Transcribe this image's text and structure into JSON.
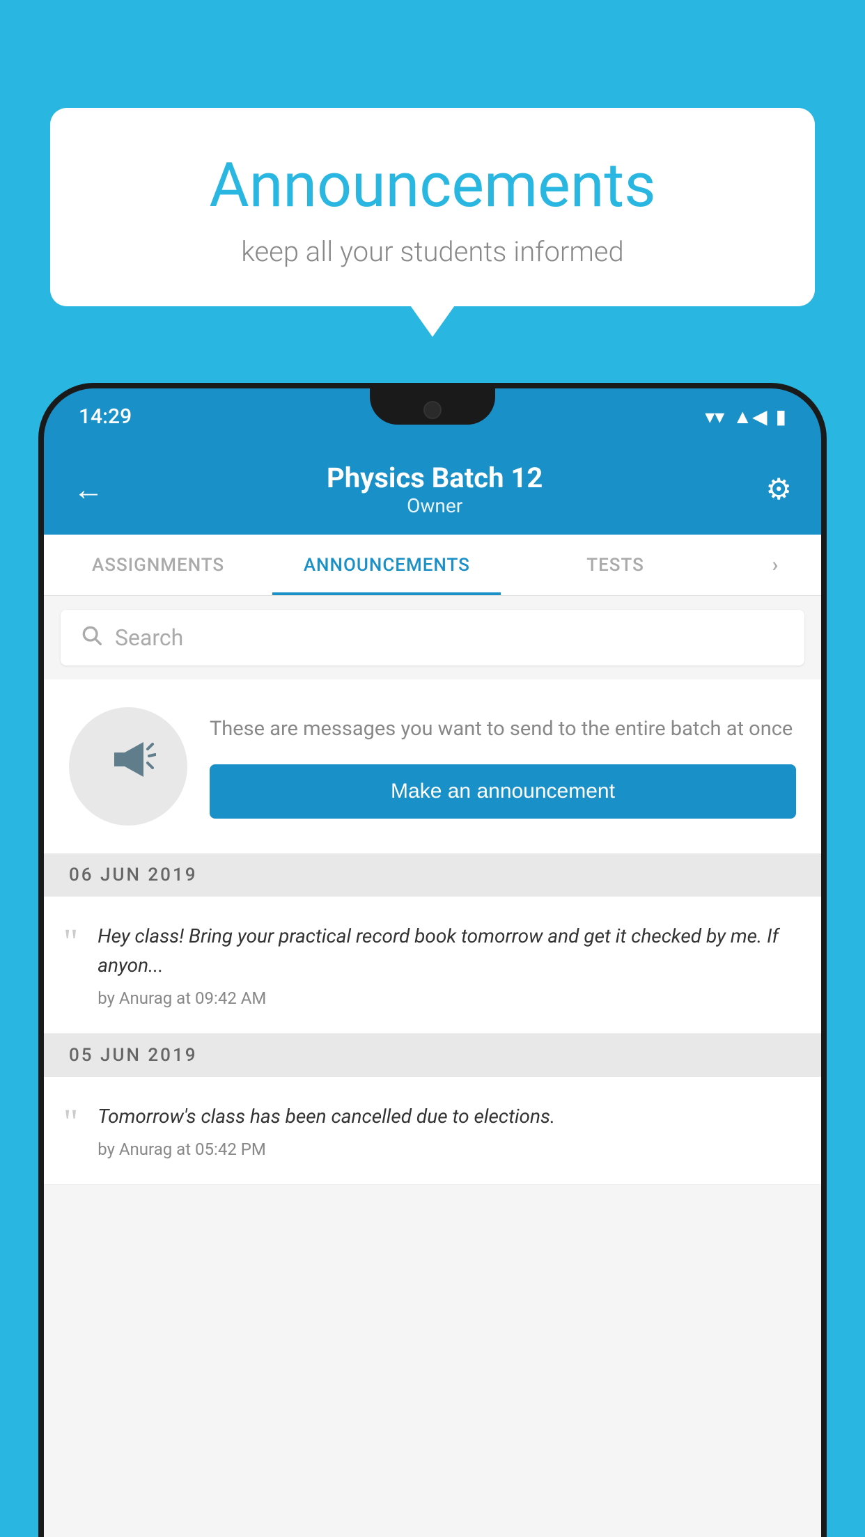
{
  "background_color": "#29b6e0",
  "bubble": {
    "title": "Announcements",
    "subtitle": "keep all your students informed"
  },
  "status_bar": {
    "time": "14:29",
    "wifi": "▼",
    "signal": "▲",
    "battery": "▮"
  },
  "header": {
    "title": "Physics Batch 12",
    "subtitle": "Owner",
    "back_label": "←",
    "gear_label": "⚙"
  },
  "tabs": [
    {
      "label": "ASSIGNMENTS",
      "active": false
    },
    {
      "label": "ANNOUNCEMENTS",
      "active": true
    },
    {
      "label": "TESTS",
      "active": false
    },
    {
      "label": "›",
      "active": false
    }
  ],
  "search": {
    "placeholder": "Search"
  },
  "empty_state": {
    "description": "These are messages you want to send to the entire batch at once",
    "button_label": "Make an announcement"
  },
  "announcements": [
    {
      "date": "06  JUN  2019",
      "text": "Hey class! Bring your practical record book tomorrow and get it checked by me. If anyon...",
      "meta": "by Anurag at 09:42 AM"
    },
    {
      "date": "05  JUN  2019",
      "text": "Tomorrow's class has been cancelled due to elections.",
      "meta": "by Anurag at 05:42 PM"
    }
  ]
}
